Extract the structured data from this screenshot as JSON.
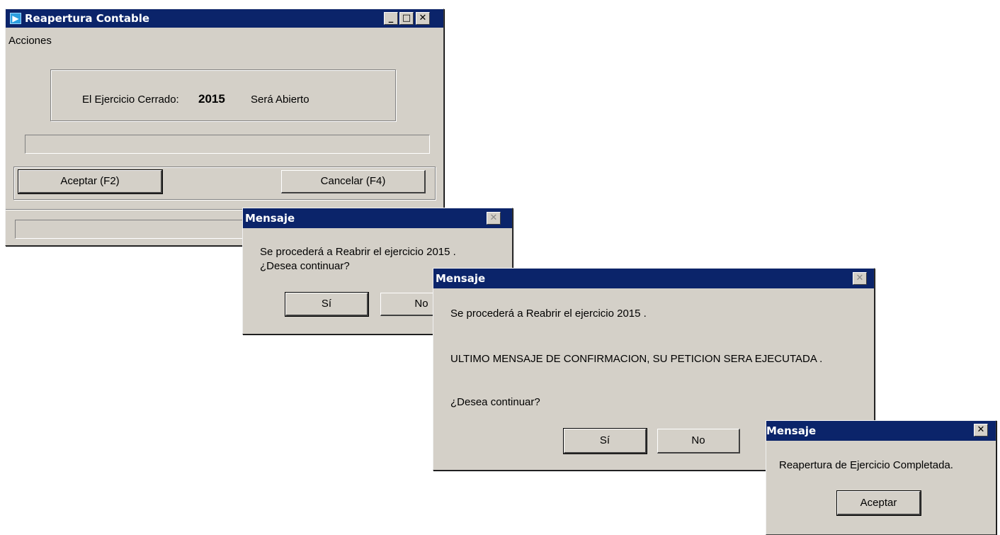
{
  "main_window": {
    "title": "Reapertura Contable",
    "menu": [
      "Acciones"
    ],
    "label_closed": "El Ejercicio Cerrado:",
    "year": "2015",
    "label_open": "Será Abierto",
    "accept_label": "Aceptar (F2)",
    "cancel_label": "Cancelar (F4)",
    "controls": {
      "minimize": "_",
      "maximize": "□",
      "close": "✕"
    }
  },
  "dialog1": {
    "title": "Mensaje",
    "line1": "Se procederá a Reabrir el ejercicio 2015 .",
    "line2": "¿Desea continuar?",
    "yes_label": "Sí",
    "no_label": "No"
  },
  "dialog2": {
    "title": "Mensaje",
    "line1": "Se procederá a Reabrir el ejercicio 2015 .",
    "line2": "ULTIMO MENSAJE DE CONFIRMACION, SU PETICION SERA EJECUTADA .",
    "line3": "¿Desea continuar?",
    "yes_label": "Sí",
    "no_label": "No"
  },
  "dialog3": {
    "title": "Mensaje",
    "message": "Reapertura de Ejercicio Completada.",
    "accept_label": "Aceptar"
  },
  "icons": {
    "app": "arrow-right-icon",
    "close": "close-icon"
  },
  "colors": {
    "titlebar": "#0b246a",
    "window": "#d4d0c8"
  }
}
